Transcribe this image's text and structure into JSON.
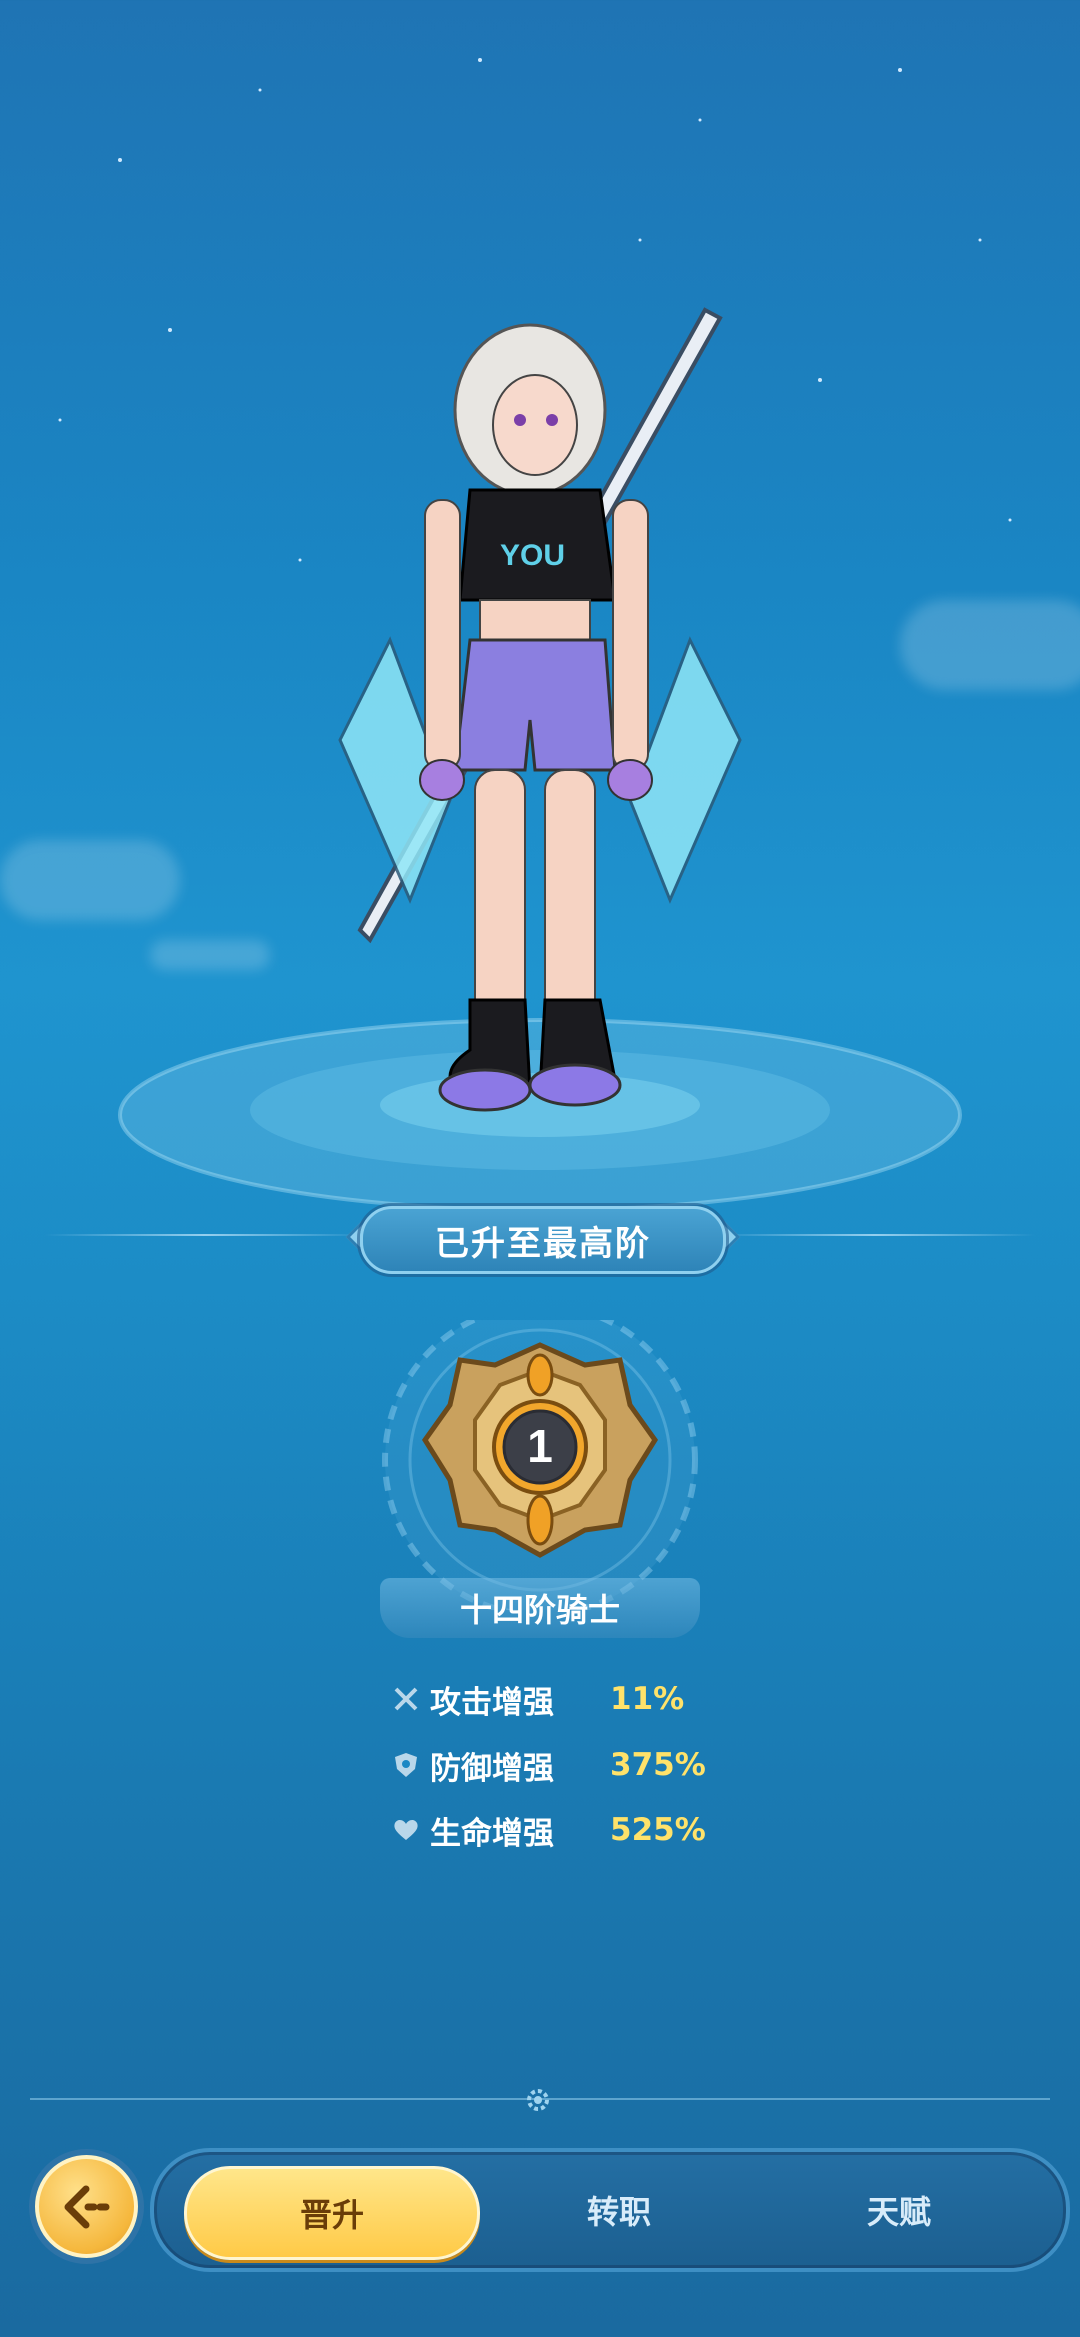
{
  "banner": {
    "max_rank_text": "已升至最高阶"
  },
  "emblem": {
    "rank_number": "1"
  },
  "rank_title": "十四阶骑士",
  "stats": [
    {
      "icon": "crossed-swords-icon",
      "label": "攻击增强",
      "value": "11%"
    },
    {
      "icon": "shield-icon",
      "label": "防御增强",
      "value": "375%"
    },
    {
      "icon": "heart-icon",
      "label": "生命增强",
      "value": "525%"
    }
  ],
  "tabs": [
    {
      "label": "晋升",
      "active": true
    },
    {
      "label": "转职",
      "active": false
    },
    {
      "label": "天赋",
      "active": false
    }
  ],
  "colors": {
    "accent_gold": "#ffca47",
    "stat_value": "#ffe26a",
    "background": "#1a86c4"
  }
}
